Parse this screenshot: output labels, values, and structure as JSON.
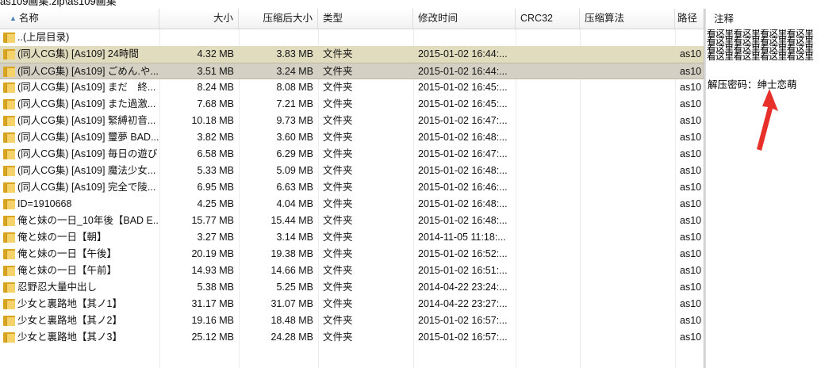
{
  "path": {
    "text": "as109画集.zip\\as109画集"
  },
  "columns": {
    "name": "名称",
    "size": "大小",
    "packed": "压缩后大小",
    "type": "类型",
    "modified": "修改时间",
    "crc": "CRC32",
    "method": "压缩算法",
    "path": "路径"
  },
  "parent_row": {
    "name": "..(上层目录)"
  },
  "rows": [
    {
      "name": "(同人CG集) [As109] 24時間",
      "size": "4.32 MB",
      "packed": "3.83 MB",
      "type": "文件夹",
      "modified": "2015-01-02 16:44:...",
      "path": "as10"
    },
    {
      "name": "(同人CG集) [As109] ごめん.や...",
      "size": "3.51 MB",
      "packed": "3.24 MB",
      "type": "文件夹",
      "modified": "2015-01-02 16:44:...",
      "path": "as10"
    },
    {
      "name": "(同人CG集) [As109] まだ　終...",
      "size": "8.24 MB",
      "packed": "8.08 MB",
      "type": "文件夹",
      "modified": "2015-01-02 16:45:...",
      "path": "as10"
    },
    {
      "name": "(同人CG集) [As109] また過激...",
      "size": "7.68 MB",
      "packed": "7.21 MB",
      "type": "文件夹",
      "modified": "2015-01-02 16:45:...",
      "path": "as10"
    },
    {
      "name": "(同人CG集) [As109] 緊縛初音...",
      "size": "10.18 MB",
      "packed": "9.73 MB",
      "type": "文件夹",
      "modified": "2015-01-02 16:47:...",
      "path": "as10"
    },
    {
      "name": "(同人CG集) [As109] 璽夢 BAD...",
      "size": "3.82 MB",
      "packed": "3.60 MB",
      "type": "文件夹",
      "modified": "2015-01-02 16:48:...",
      "path": "as10"
    },
    {
      "name": "(同人CG集) [As109] 毎日の遊び",
      "size": "6.58 MB",
      "packed": "6.29 MB",
      "type": "文件夹",
      "modified": "2015-01-02 16:47:...",
      "path": "as10"
    },
    {
      "name": "(同人CG集) [As109] 魔法少女...",
      "size": "5.33 MB",
      "packed": "5.09 MB",
      "type": "文件夹",
      "modified": "2015-01-02 16:48:...",
      "path": "as10"
    },
    {
      "name": "(同人CG集) [As109] 完全で陵...",
      "size": "6.95 MB",
      "packed": "6.63 MB",
      "type": "文件夹",
      "modified": "2015-01-02 16:46:...",
      "path": "as10"
    },
    {
      "name": "ID=1910668",
      "size": "4.25 MB",
      "packed": "4.04 MB",
      "type": "文件夹",
      "modified": "2015-01-02 16:48:...",
      "path": "as10"
    },
    {
      "name": "俺と妹の一日_10年後【BAD E...",
      "size": "15.77 MB",
      "packed": "15.44 MB",
      "type": "文件夹",
      "modified": "2015-01-02 16:48:...",
      "path": "as10"
    },
    {
      "name": "俺と妹の一日【朝】",
      "size": "3.27 MB",
      "packed": "3.14 MB",
      "type": "文件夹",
      "modified": "2014-11-05 11:18:...",
      "path": "as10"
    },
    {
      "name": "俺と妹の一日【午後】",
      "size": "20.19 MB",
      "packed": "19.38 MB",
      "type": "文件夹",
      "modified": "2015-01-02 16:52:...",
      "path": "as10"
    },
    {
      "name": "俺と妹の一日【午前】",
      "size": "14.93 MB",
      "packed": "14.66 MB",
      "type": "文件夹",
      "modified": "2015-01-02 16:51:...",
      "path": "as10"
    },
    {
      "name": "忍野忍大量中出し",
      "size": "5.38 MB",
      "packed": "5.25 MB",
      "type": "文件夹",
      "modified": "2014-04-22 23:24:...",
      "path": "as10"
    },
    {
      "name": "少女と裏路地【其ノ1】",
      "size": "31.17 MB",
      "packed": "31.07 MB",
      "type": "文件夹",
      "modified": "2014-04-22 23:27:...",
      "path": "as10"
    },
    {
      "name": "少女と裏路地【其ノ2】",
      "size": "19.16 MB",
      "packed": "18.48 MB",
      "type": "文件夹",
      "modified": "2015-01-02 16:57:...",
      "path": "as10"
    },
    {
      "name": "少女と裏路地【其ノ3】",
      "size": "25.12 MB",
      "packed": "24.28 MB",
      "type": "文件夹",
      "modified": "2015-01-02 16:57:...",
      "path": "as10"
    }
  ],
  "notes": {
    "title": "注释",
    "lines": [
      "看这里看这里看这里看这里",
      "看这里看这里看这里看这里",
      "看这里看这里看这里看这里",
      "看这里看这里看这里看这里"
    ],
    "password": "解压密码：绅士恋萌"
  },
  "colors": {
    "selected_row": "#e2dcbf",
    "selected_row_2": "#d4d1c4",
    "arrow": "#e8302a",
    "folder": "#f6d26a"
  }
}
